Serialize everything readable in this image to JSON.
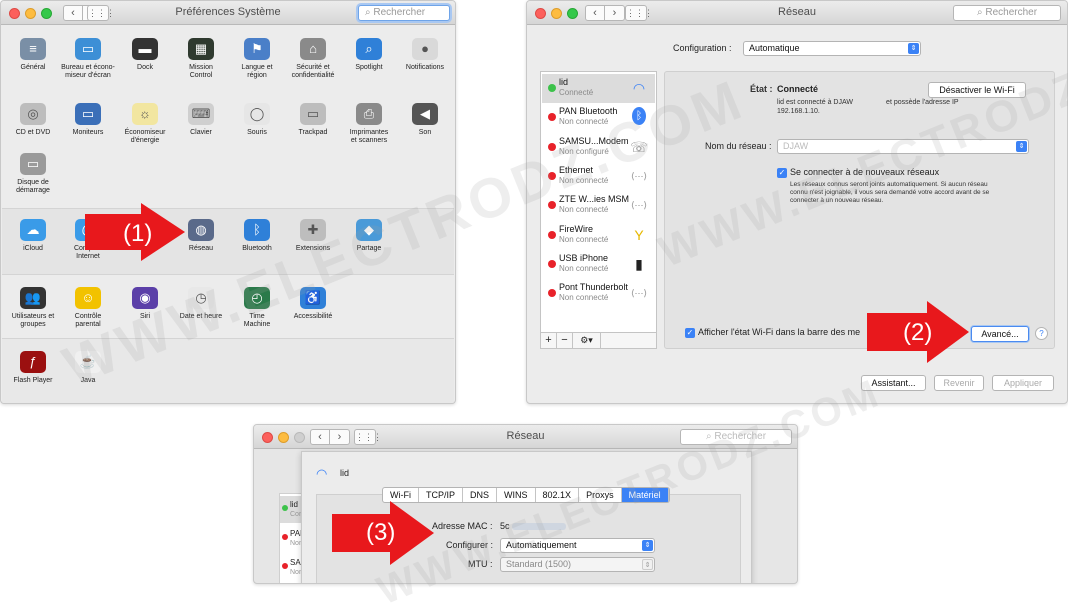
{
  "win1": {
    "title": "Préférences Système",
    "search_placeholder": "Rechercher",
    "row1": [
      {
        "label": "Général",
        "icon": "general-icon",
        "color": "#7a8fa6",
        "glyph": "≡"
      },
      {
        "label": "Bureau et écono-\nmiseur d'écran",
        "icon": "desktop-icon",
        "color": "#3d8fd6",
        "glyph": "▭"
      },
      {
        "label": "Dock",
        "icon": "dock-icon",
        "color": "#333333",
        "glyph": "▬"
      },
      {
        "label": "Mission\nControl",
        "icon": "mission-control-icon",
        "color": "#2f3a2f",
        "glyph": "▦"
      },
      {
        "label": "Langue et\nrégion",
        "icon": "language-icon",
        "color": "#4a7fc8",
        "glyph": "⚑"
      },
      {
        "label": "Sécurité et\nconfidentialité",
        "icon": "security-icon",
        "color": "#8a8a8a",
        "glyph": "⌂"
      },
      {
        "label": "Spotlight",
        "icon": "spotlight-icon",
        "color": "#2f80d8",
        "glyph": "⌕"
      },
      {
        "label": "Notifications",
        "icon": "notifications-icon",
        "color": "#d9d9d9",
        "glyph": "●"
      }
    ],
    "row2": [
      {
        "label": "CD et DVD",
        "icon": "cd-dvd-icon",
        "color": "#bdbdbd",
        "glyph": "◎"
      },
      {
        "label": "Moniteurs",
        "icon": "displays-icon",
        "color": "#3b6fb8",
        "glyph": "▭"
      },
      {
        "label": "Économiseur\nd'énergie",
        "icon": "energy-saver-icon",
        "color": "#f2e6a0",
        "glyph": "☼"
      },
      {
        "label": "Clavier",
        "icon": "keyboard-icon",
        "color": "#cfcfcf",
        "glyph": "⌨"
      },
      {
        "label": "Souris",
        "icon": "mouse-icon",
        "color": "#e6e6e6",
        "glyph": "◯"
      },
      {
        "label": "Trackpad",
        "icon": "trackpad-icon",
        "color": "#bdbdbd",
        "glyph": "▭"
      },
      {
        "label": "Imprimantes\net scanners",
        "icon": "printer-icon",
        "color": "#8a8a8a",
        "glyph": "⎙"
      },
      {
        "label": "Son",
        "icon": "sound-icon",
        "color": "#555555",
        "glyph": "◀"
      }
    ],
    "row2b": [
      {
        "label": "Disque de\ndémarrage",
        "icon": "startup-disk-icon",
        "color": "#9a9a9a",
        "glyph": "▭"
      }
    ],
    "row3": [
      {
        "label": "iCloud",
        "icon": "icloud-icon",
        "color": "#3a9be8",
        "glyph": "☁"
      },
      {
        "label": "Comptes\nInternet",
        "icon": "internet-accounts-icon",
        "color": "#3a9be8",
        "glyph": "@"
      },
      {
        "label": "Ap",
        "icon": "app-store-icon",
        "color": "#3a9be8",
        "glyph": "A"
      },
      {
        "label": "Réseau",
        "icon": "network-globe-icon",
        "color": "#5a6a8a",
        "glyph": "◍"
      },
      {
        "label": "Bluetooth",
        "icon": "bluetooth-icon",
        "color": "#2f80d8",
        "glyph": "ᛒ"
      },
      {
        "label": "Extensions",
        "icon": "extensions-icon",
        "color": "#bdbdbd",
        "glyph": "✚"
      },
      {
        "label": "Partage",
        "icon": "sharing-icon",
        "color": "#4a9ad8",
        "glyph": "◆"
      }
    ],
    "row4": [
      {
        "label": "Utilisateurs et\ngroupes",
        "icon": "users-icon",
        "color": "#333333",
        "glyph": "👥"
      },
      {
        "label": "Contrôle\nparental",
        "icon": "parental-controls-icon",
        "color": "#f2c200",
        "glyph": "☺"
      },
      {
        "label": "Siri",
        "icon": "siri-icon",
        "color": "#5b3fa8",
        "glyph": "◉"
      },
      {
        "label": "Date et heure",
        "icon": "date-time-icon",
        "color": "#e8e8e8",
        "glyph": "◷"
      },
      {
        "label": "Time\nMachine",
        "icon": "time-machine-icon",
        "color": "#2a7a4a",
        "glyph": "◴"
      },
      {
        "label": "Accessibilité",
        "icon": "accessibility-icon",
        "color": "#2f80d8",
        "glyph": "♿"
      }
    ],
    "row5": [
      {
        "label": "Flash Player",
        "icon": "flash-player-icon",
        "color": "#9b1010",
        "glyph": "ƒ"
      },
      {
        "label": "Java",
        "icon": "java-icon",
        "color": "#f0f0f0",
        "glyph": "☕"
      }
    ],
    "arrow_label": "(1)"
  },
  "win2": {
    "title": "Réseau",
    "search_placeholder": "Rechercher",
    "config_label": "Configuration :",
    "config_value": "Automatique",
    "services": [
      {
        "name": "lid",
        "status": "Connecté",
        "dot": "#3cc24a",
        "icon": "wifi-icon",
        "glyph": "◠"
      },
      {
        "name": "PAN Bluetooth",
        "status": "Non connecté",
        "dot": "#e8222a",
        "icon": "bluetooth-icon",
        "glyph": "ᛒ"
      },
      {
        "name": "SAMSU...Modem",
        "status": "Non configuré",
        "dot": "#e8222a",
        "icon": "phone-icon",
        "glyph": "☏"
      },
      {
        "name": "Ethernet",
        "status": "Non connecté",
        "dot": "#e8222a",
        "icon": "ethernet-icon",
        "glyph": "⟨⋯⟩"
      },
      {
        "name": "ZTE W...ies MSM",
        "status": "Non connecté",
        "dot": "#e8222a",
        "icon": "modem-icon",
        "glyph": "⟨⋯⟩"
      },
      {
        "name": "FireWire",
        "status": "Non connecté",
        "dot": "#e8222a",
        "icon": "firewire-icon",
        "glyph": "Y"
      },
      {
        "name": "USB iPhone",
        "status": "Non connecté",
        "dot": "#e8222a",
        "icon": "iphone-icon",
        "glyph": "▮"
      },
      {
        "name": "Pont Thunderbolt",
        "status": "Non connecté",
        "dot": "#e8222a",
        "icon": "thunderbolt-bridge-icon",
        "glyph": "⟨⋯⟩"
      }
    ],
    "list_buttons": [
      "+",
      "−",
      "⚙▾"
    ],
    "state_label": "État :",
    "state_value": "Connecté",
    "disable_wifi": "Désactiver le Wi-Fi",
    "state_desc": "lid est connecté à DJAW                 et possède l'adresse IP\n192.168.1.10.",
    "network_name_label": "Nom du réseau :",
    "network_name_value": "DJAW",
    "join_new_label": "Se connecter à de nouveaux réseaux",
    "join_new_desc": "Les réseaux connus seront joints automatiquement. Si aucun réseau\nconnu n'est joignable, il vous sera demandé votre accord avant de se\nconnecter à un nouveau réseau.",
    "show_wifi_label": "Afficher l'état Wi-Fi dans la barre des me",
    "advanced_button": "Avancé...",
    "help_button": "?",
    "assistant_button": "Assistant...",
    "revert_button": "Revenir",
    "apply_button": "Appliquer",
    "arrow_label": "(2)"
  },
  "win3": {
    "title": "Réseau",
    "search_placeholder": "Rechercher",
    "sheet_title": "lid",
    "tabs": [
      "Wi-Fi",
      "TCP/IP",
      "DNS",
      "WINS",
      "802.1X",
      "Proxys",
      "Matériel"
    ],
    "selected_tab": "Matériel",
    "mac_label": "Adresse MAC :",
    "mac_value": "5c",
    "configure_label": "Configurer :",
    "configure_value": "Automatiquement",
    "mtu_label": "MTU :",
    "mtu_value": "Standard  (1500)",
    "side_items": [
      {
        "name": "lid",
        "status": "Con"
      },
      {
        "name": "PAN",
        "status": "Non"
      },
      {
        "name": "SAN",
        "status": "Non"
      }
    ],
    "arrow_label": "(3)"
  },
  "watermark": "WWW.ELECTRODZ.COM"
}
